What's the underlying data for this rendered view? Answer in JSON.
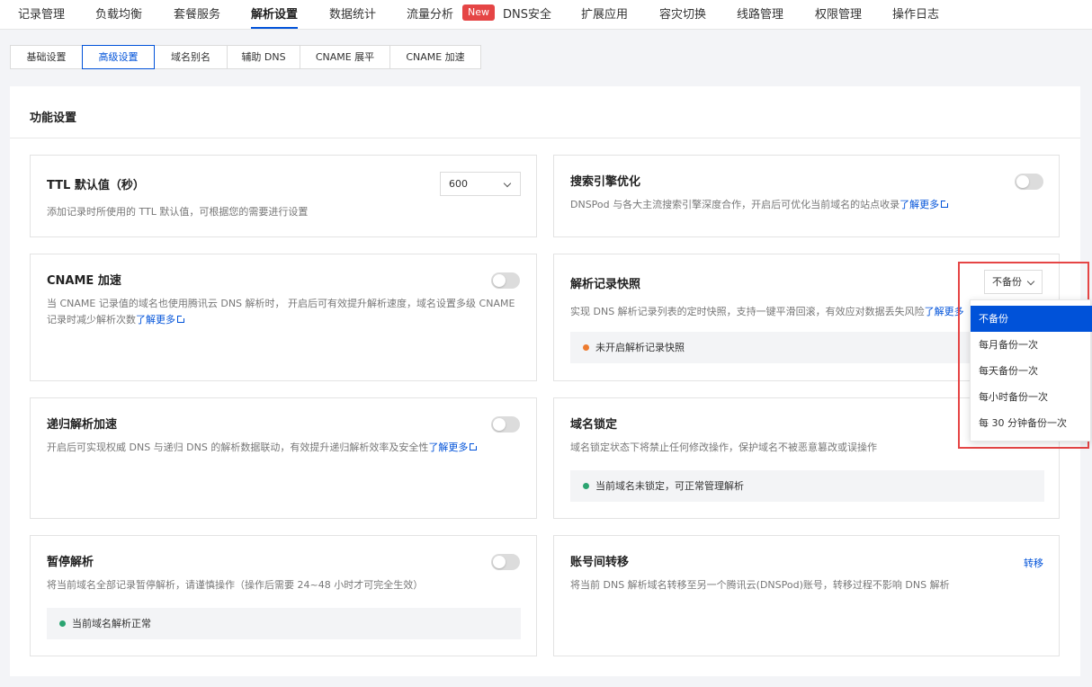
{
  "nav": {
    "items": [
      "记录管理",
      "负载均衡",
      "套餐服务",
      "解析设置",
      "数据统计",
      "流量分析",
      "DNS安全",
      "扩展应用",
      "容灾切换",
      "线路管理",
      "权限管理",
      "操作日志"
    ],
    "active": "解析设置",
    "new_badge": "New"
  },
  "subtabs": {
    "items": [
      "基础设置",
      "高级设置",
      "域名别名",
      "辅助 DNS",
      "CNAME 展平",
      "CNAME 加速"
    ],
    "active": "高级设置"
  },
  "panel": {
    "title": "功能设置"
  },
  "cards": {
    "ttl": {
      "title": "TTL 默认值（秒）",
      "desc": "添加记录时所使用的 TTL 默认值，可根据您的需要进行设置",
      "value": "600"
    },
    "seo": {
      "title": "搜索引擎优化",
      "desc": "DNSPod 与各大主流搜索引擎深度合作，开启后可优化当前域名的站点收录",
      "learn_more": "了解更多"
    },
    "cname": {
      "title": "CNAME 加速",
      "desc": "当 CNAME 记录值的域名也使用腾讯云 DNS 解析时， 开启后可有效提升解析速度，域名设置多级 CNAME 记录时减少解析次数",
      "learn_more": "了解更多"
    },
    "snapshot": {
      "title": "解析记录快照",
      "desc": "实现 DNS 解析记录列表的定时快照，支持一键平滑回滚，有效应对数据丢失风险",
      "learn_more": "了解更多",
      "select_value": "不备份",
      "status": "未开启解析记录快照",
      "status_color": "#ed7b2f",
      "options": [
        "不备份",
        "每月备份一次",
        "每天备份一次",
        "每小时备份一次",
        "每 30 分钟备份一次"
      ]
    },
    "recursive": {
      "title": "递归解析加速",
      "desc": "开启后可实现权威 DNS 与递归 DNS 的解析数据联动，有效提升递归解析效率及安全性",
      "learn_more": "了解更多"
    },
    "lock": {
      "title": "域名锁定",
      "desc": "域名锁定状态下将禁止任何修改操作，保护域名不被恶意篡改或误操作",
      "status": "当前域名未锁定，可正常管理解析",
      "status_color": "#2ba471"
    },
    "pause": {
      "title": "暂停解析",
      "desc": "将当前域名全部记录暂停解析，请谨慎操作（操作后需要 24~48 小时才可完全生效）",
      "status": "当前域名解析正常",
      "status_color": "#2ba471"
    },
    "transfer": {
      "title": "账号间转移",
      "desc": "将当前 DNS 解析域名转移至另一个腾讯云(DNSPod)账号，转移过程不影响 DNS 解析",
      "action": "转移"
    }
  },
  "colors": {
    "accent": "#0052d9",
    "highlight": "#e54545"
  }
}
